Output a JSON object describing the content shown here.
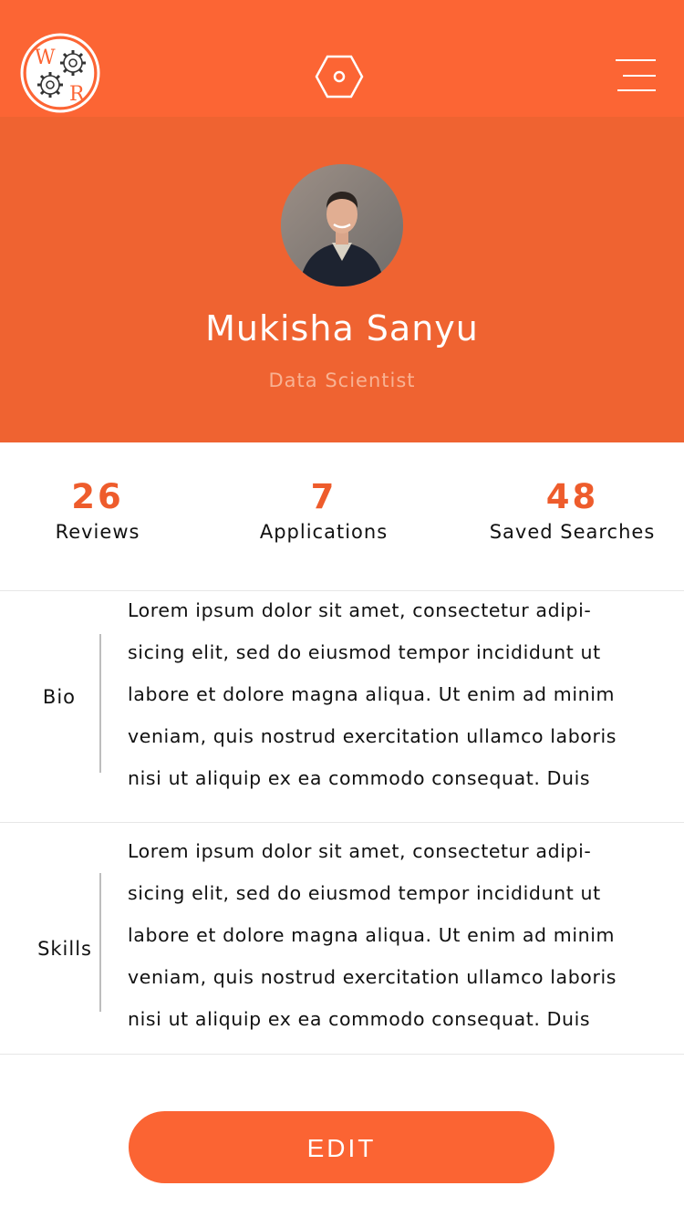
{
  "header": {
    "logo_text": "W R",
    "icons": [
      "logo-gears-icon",
      "hexagon-icon",
      "hamburger-menu-icon"
    ]
  },
  "profile": {
    "name": "Mukisha Sanyu",
    "role": "Data Scientist"
  },
  "stats": [
    {
      "value": "26",
      "label": "Reviews"
    },
    {
      "value": "7",
      "label": "Applications"
    },
    {
      "value": "48",
      "label": "Saved Searches"
    }
  ],
  "sections": [
    {
      "label": "Bio",
      "lines": [
        "Lorem ipsum dolor sit amet, consectetur adipi-",
        "sicing elit, sed do eiusmod tempor incididunt ut",
        "labore et dolore magna aliqua. Ut enim ad minim",
        "veniam, quis nostrud exercitation ullamco laboris",
        "nisi ut aliquip ex ea commodo consequat. Duis"
      ]
    },
    {
      "label": "Skills",
      "lines": [
        "Lorem ipsum dolor sit amet, consectetur adipi-",
        "sicing elit, sed do eiusmod tempor incididunt ut",
        "labore et dolore magna aliqua. Ut enim ad minim",
        "veniam, quis nostrud exercitation ullamco laboris",
        "nisi ut aliquip ex ea commodo consequat. Duis"
      ]
    }
  ],
  "actions": {
    "edit_label": "EDIT"
  },
  "colors": {
    "primary": "#fc6534",
    "profile_bg": "#ef6331",
    "stat_number": "#ee5c2c",
    "role_text": "#f8b293"
  }
}
